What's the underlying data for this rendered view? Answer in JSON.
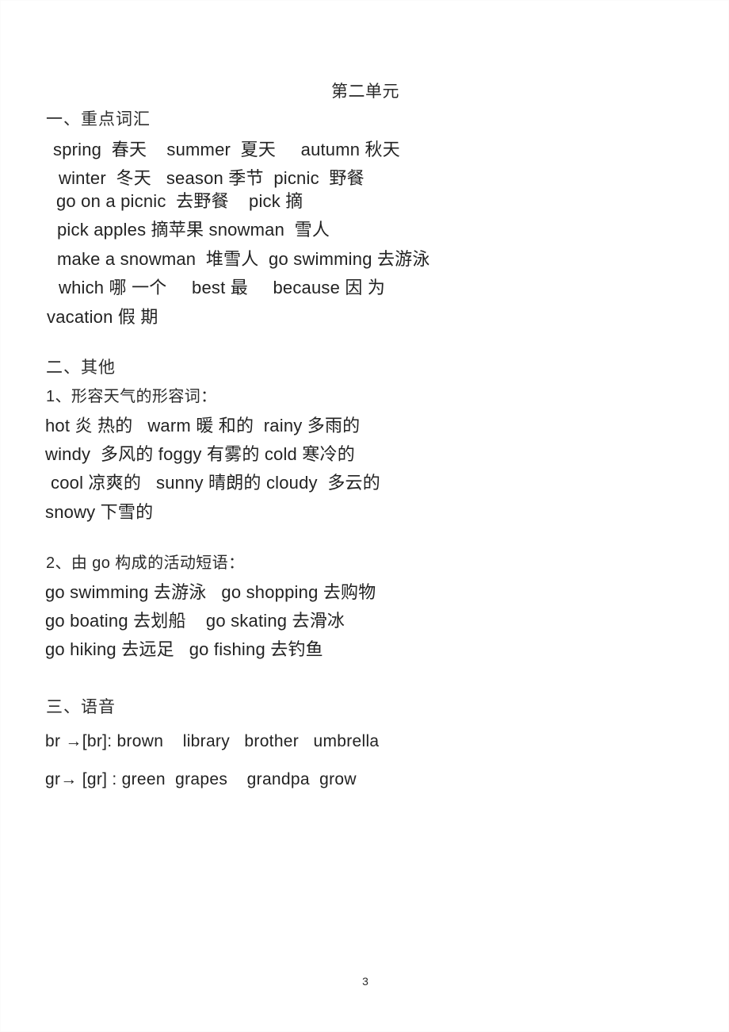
{
  "document": {
    "title": "第二单元",
    "page_number": "3"
  },
  "sections": [
    {
      "heading": "一、重点词汇",
      "lines": [
        "spring  春天    summer  夏天     autumn 秋天",
        "winter  冬天   season 季节  picnic  野餐",
        "go on a picnic  去野餐    pick 摘",
        "pick apples 摘苹果 snowman  雪人",
        "make a snowman  堆雪人  go swimming 去游泳",
        "which 哪 一个     best 最     because 因 为",
        "vacation 假 期"
      ]
    },
    {
      "heading": "二、其他",
      "subsections": [
        {
          "heading": "1、形容天气的形容词：",
          "lines": [
            "hot 炎 热的   warm 暖 和的  rainy 多雨的",
            "windy  多风的 foggy 有雾的 cold 寒冷的",
            "cool 凉爽的   sunny 晴朗的 cloudy  多云的",
            "snowy 下雪的"
          ]
        },
        {
          "heading": "2、由 go 构成的活动短语：",
          "lines": [
            "go swimming 去游泳   go shopping 去购物",
            "go boating 去划船    go skating 去滑冰",
            "go hiking 去远足   go fishing 去钓鱼"
          ]
        }
      ]
    },
    {
      "heading": "三、语音",
      "lines": [
        "br →[br]: brown    library   brother   umbrella",
        "gr→ [gr] : green  grapes    grandpa  grow"
      ]
    }
  ]
}
